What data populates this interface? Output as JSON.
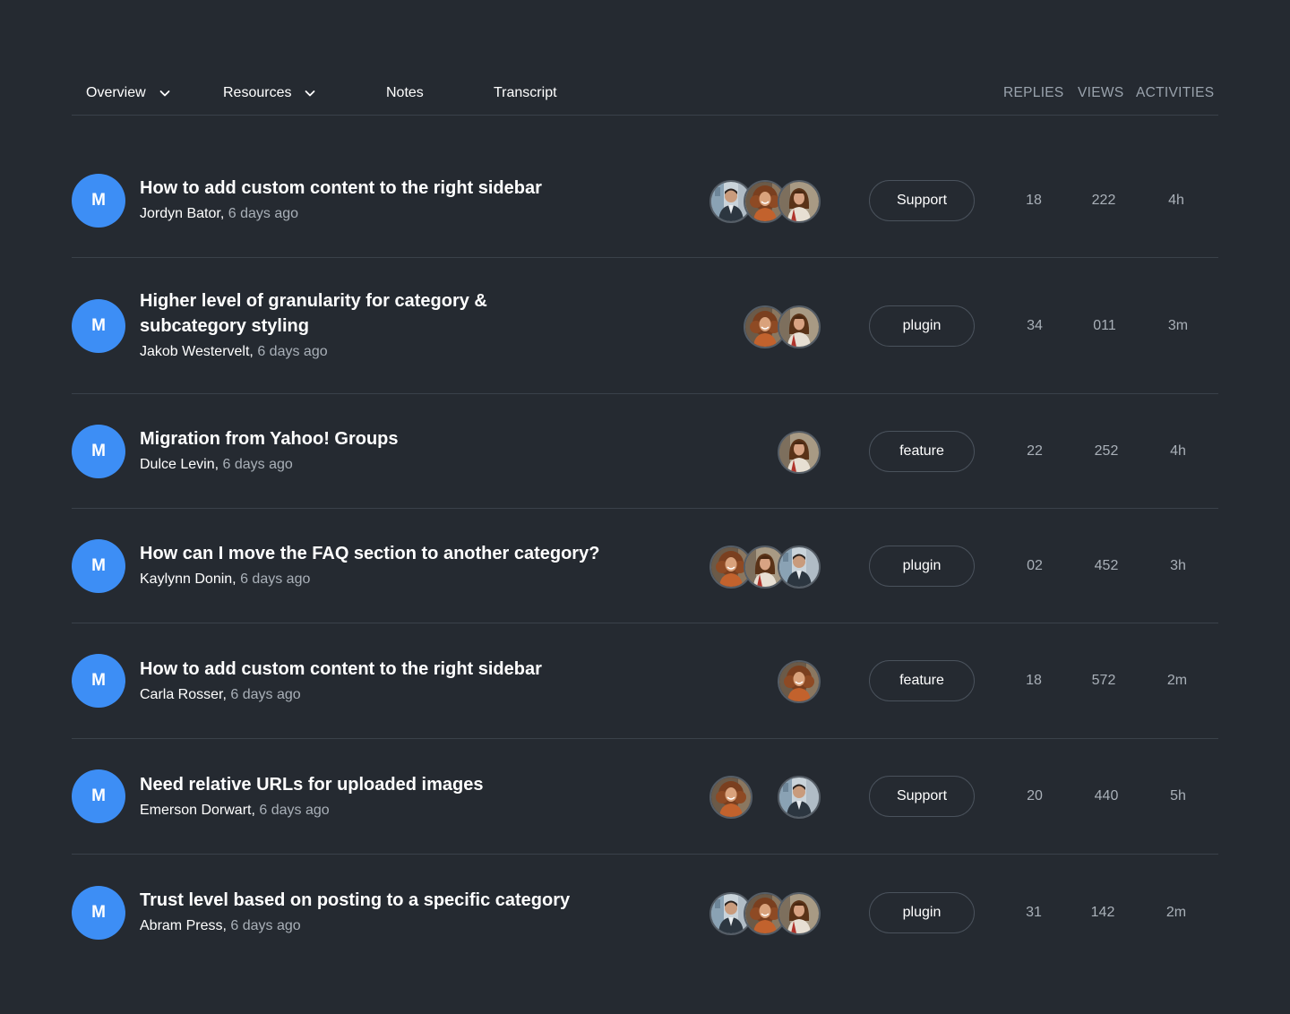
{
  "tabs": [
    {
      "label": "Overview",
      "has_dropdown": true
    },
    {
      "label": "Resources",
      "has_dropdown": true
    },
    {
      "label": "Notes",
      "has_dropdown": false
    },
    {
      "label": "Transcript",
      "has_dropdown": false
    }
  ],
  "columns": {
    "replies": "REPLIES",
    "views": "VIEWS",
    "activities": "ACTIVITIES"
  },
  "colors": {
    "background": "#252a31",
    "accent": "#3d8ef5",
    "divider": "#3a414a",
    "muted_text": "#a9b0b8"
  },
  "topics": [
    {
      "avatar_letter": "M",
      "title": "How to add custom content to the right sidebar",
      "author": "Jordyn Bator,",
      "time": "6 days ago",
      "participants": [
        "man-photo",
        "curly-woman-photo",
        "woman-photo"
      ],
      "tag": "Support",
      "replies": "18",
      "views": "222",
      "activity": "4h"
    },
    {
      "avatar_letter": "M",
      "title": "Higher level of granularity for category & subcategory styling",
      "author": "Jakob Westervelt,",
      "time": "6 days ago",
      "participants": [
        "curly-woman-photo",
        "woman-photo"
      ],
      "tag": "plugin",
      "replies": "34",
      "views": "011",
      "activity": "3m"
    },
    {
      "avatar_letter": "M",
      "title": "Migration from Yahoo! Groups",
      "author": "Dulce Levin,",
      "time": "6 days ago",
      "participants": [
        "woman-photo"
      ],
      "tag": "feature",
      "replies": "22",
      "views": "252",
      "activity": "4h"
    },
    {
      "avatar_letter": "M",
      "title": "How can I move the FAQ section to another category?",
      "author": "Kaylynn Donin,",
      "time": "6 days ago",
      "participants": [
        "curly-woman-photo",
        "woman-photo",
        "man-photo"
      ],
      "tag": "plugin",
      "replies": "02",
      "views": "452",
      "activity": "3h"
    },
    {
      "avatar_letter": "M",
      "title": "How to add custom content to the right sidebar",
      "author": "Carla Rosser,",
      "time": "6 days ago",
      "participants": [
        "curly-woman-photo"
      ],
      "tag": "feature",
      "replies": "18",
      "views": "572",
      "activity": "2m"
    },
    {
      "avatar_letter": "M",
      "title": "Need relative URLs for uploaded images",
      "author": "Emerson Dorwart,",
      "time": "6 days ago",
      "participants": [
        "curly-woman-photo",
        "man-photo"
      ],
      "tag": "Support",
      "replies": "20",
      "views": "440",
      "activity": "5h"
    },
    {
      "avatar_letter": "M",
      "title": "Trust level based on posting to a specific category",
      "author": "Abram Press,",
      "time": "6 days ago",
      "participants": [
        "man-photo",
        "curly-woman-photo",
        "woman-photo"
      ],
      "tag": "plugin",
      "replies": "31",
      "views": "142",
      "activity": "2m"
    }
  ]
}
